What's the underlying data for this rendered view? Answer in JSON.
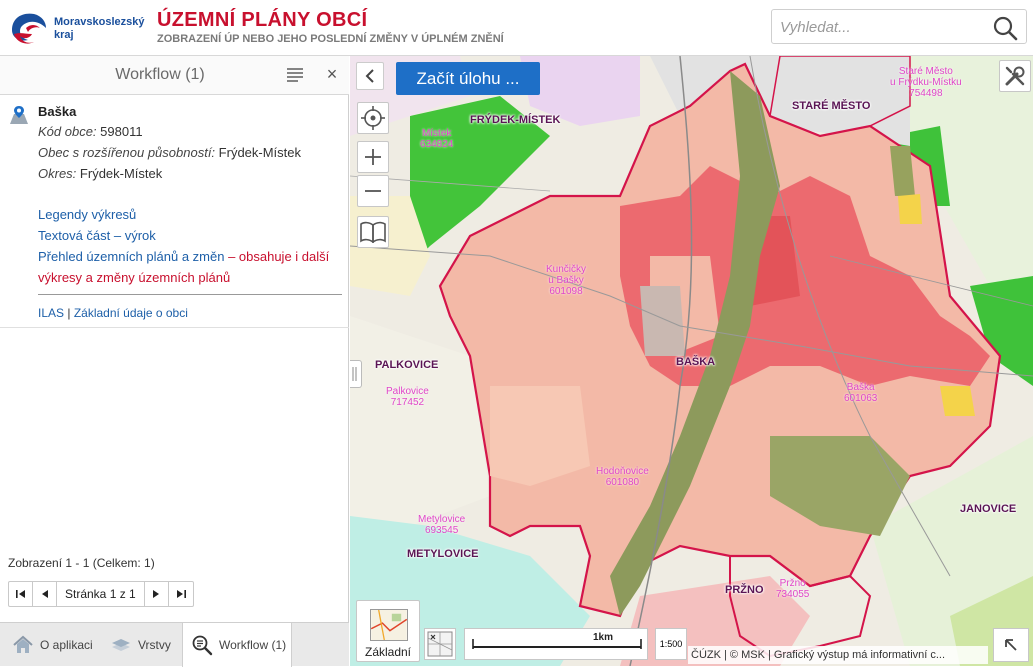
{
  "header": {
    "logo_text_line1": "Moravskoslezský",
    "logo_text_line2": "kraj",
    "title": "ÚZEMNÍ PLÁNY OBCÍ",
    "subtitle": "ZOBRAZENÍ ÚP NEBO JEHO POSLEDNÍ ZMĚNY V ÚPLNÉM ZNĚNÍ",
    "search_placeholder": "Vyhledat..."
  },
  "panel": {
    "title": "Workflow (1)",
    "close_label": "×",
    "record": {
      "name": "Baška",
      "kod_label": "Kód obce:",
      "kod_value": "598011",
      "orp_label": "Obec s rozšířenou působností:",
      "orp_value": "Frýdek-Místek",
      "okres_label": "Okres:",
      "okres_value": "Frýdek-Místek",
      "link_legendy": "Legendy výkresů",
      "link_textova": "Textová část – výrok",
      "link_prehled": "Přehled územních plánů a změn",
      "link_prehled_note_1": " – obsahuje i další",
      "link_prehled_note_2": "výkresy a změny územních plánů",
      "link_ilas": "ILAS",
      "link_sep": " | ",
      "link_zakladni": "Základní údaje o obci"
    },
    "pager_info": "Zobrazení 1 - 1 (Celkem: 1)",
    "pager_label": "Stránka 1 z 1"
  },
  "tabs": [
    {
      "label": "O aplikaci"
    },
    {
      "label": "Vrstvy"
    },
    {
      "label": "Workflow (1)"
    }
  ],
  "map": {
    "start_task": "Začít úlohu ...",
    "basemap_label": "Základní",
    "scale_label": "1km",
    "scale_btn_label": "1:500",
    "attribution": "ČÚZK | © MSK | Grafický výstup má informativní c...",
    "labels": {
      "frydek": "FRÝDEK-MÍSTEK",
      "stare_mesto": "STARÉ MĚSTO",
      "palkovice": "PALKOVICE",
      "baska": "BAŠKA",
      "janovice": "JANOVICE",
      "metylovice": "METYLOVICE",
      "przno": "PRŽNO"
    },
    "sublabels": {
      "mistek_1": "Místek",
      "mistek_2": "634824",
      "stare_1": "Staré Město",
      "stare_2": "u Frýdku-Místku",
      "stare_3": "754498",
      "kuncicky_1": "Kunčičky",
      "kuncicky_2": "u Bašky",
      "kuncicky_3": "601098",
      "palkovice_1": "Palkovice",
      "palkovice_2": "717452",
      "baska_1": "Baška",
      "baska_2": "601063",
      "hodonovice_1": "Hodoňovice",
      "hodonovice_2": "601080",
      "metylovice_1": "Metylovice",
      "metylovice_2": "693545",
      "przno_1": "Pržno",
      "przno_2": "734055"
    }
  }
}
